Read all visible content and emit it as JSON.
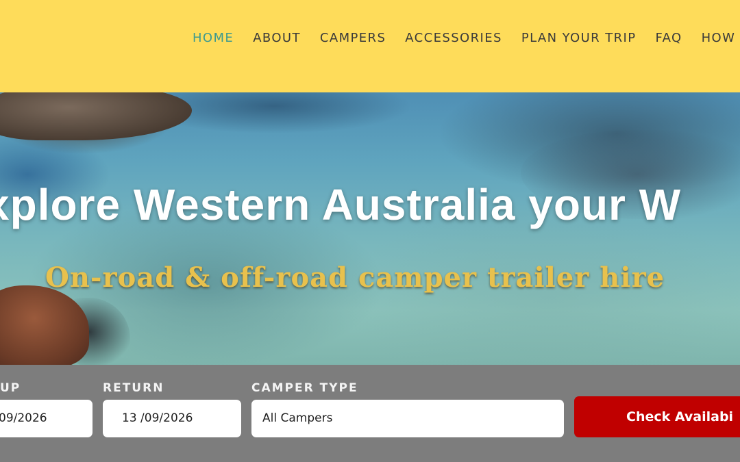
{
  "nav": {
    "items": [
      {
        "label": "HOME",
        "active": true
      },
      {
        "label": "ABOUT",
        "active": false
      },
      {
        "label": "CAMPERS",
        "active": false
      },
      {
        "label": "ACCESSORIES",
        "active": false
      },
      {
        "label": "PLAN YOUR TRIP",
        "active": false
      },
      {
        "label": "FAQ",
        "active": false
      },
      {
        "label": "HOW T",
        "active": false
      }
    ]
  },
  "hero": {
    "title": "xplore Western Australia your W",
    "subtitle": "On-road & off-road camper trailer hire"
  },
  "booking": {
    "pickup_label": "UP",
    "pickup_value": "09/2026",
    "return_label": "RETURN",
    "return_value": "13 /09/2026",
    "camper_type_label": "CAMPER TYPE",
    "camper_type_value": "All Campers",
    "check_button": "Check Availabi"
  },
  "colors": {
    "header_bg": "#fedc5a",
    "nav_active": "#3f9a8e",
    "nav_text": "#3a3a3a",
    "subtitle_gold": "#e8c14d",
    "booking_bg": "#7d7d7d",
    "button_red": "#c00000"
  }
}
